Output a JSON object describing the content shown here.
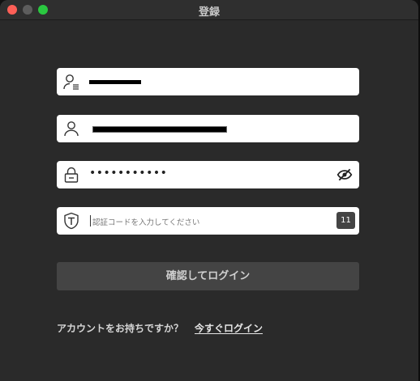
{
  "window": {
    "title": "登録"
  },
  "form": {
    "username": {
      "icon": "user-card-icon"
    },
    "name": {
      "icon": "user-icon"
    },
    "password": {
      "masked_value": "•••••••••••",
      "icon": "lock-icon",
      "toggle_icon": "eye-hidden-icon"
    },
    "code": {
      "icon": "t-shield-icon",
      "placeholder": "認証コードを入力してください",
      "countdown": "11"
    }
  },
  "actions": {
    "login_button": "確認してログイン",
    "prompt_text": "アカウントをお持ちですか？",
    "login_link": "今すぐログイン"
  },
  "colors": {
    "background": "#2a2a2a",
    "button": "#444444",
    "close": "#fe5f57",
    "maximize": "#2ac840"
  }
}
